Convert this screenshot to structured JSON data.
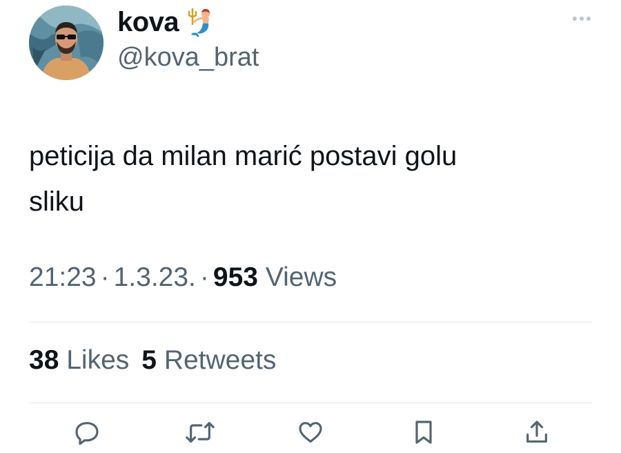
{
  "user": {
    "display_name": "kova",
    "handle": "@kova_brat",
    "name_emoji_icon": "merman-emoji-icon",
    "avatar_icon": "profile-avatar"
  },
  "tweet": {
    "line1": "peticija da milan marić postavi golu",
    "line2": "sliku"
  },
  "meta": {
    "time": "21:23",
    "date": "1.3.23.",
    "views_count": "953",
    "views_label": "Views"
  },
  "stats": {
    "likes_count": "38",
    "likes_label": "Likes",
    "retweets_count": "5",
    "retweets_label": "Retweets"
  },
  "actions": [
    "reply-icon",
    "retweet-icon",
    "like-icon",
    "bookmark-icon",
    "share-icon"
  ],
  "colors": {
    "text_primary": "#0f1419",
    "text_secondary": "#536471",
    "icon": "#536471",
    "divider": "#e4e7ea"
  }
}
